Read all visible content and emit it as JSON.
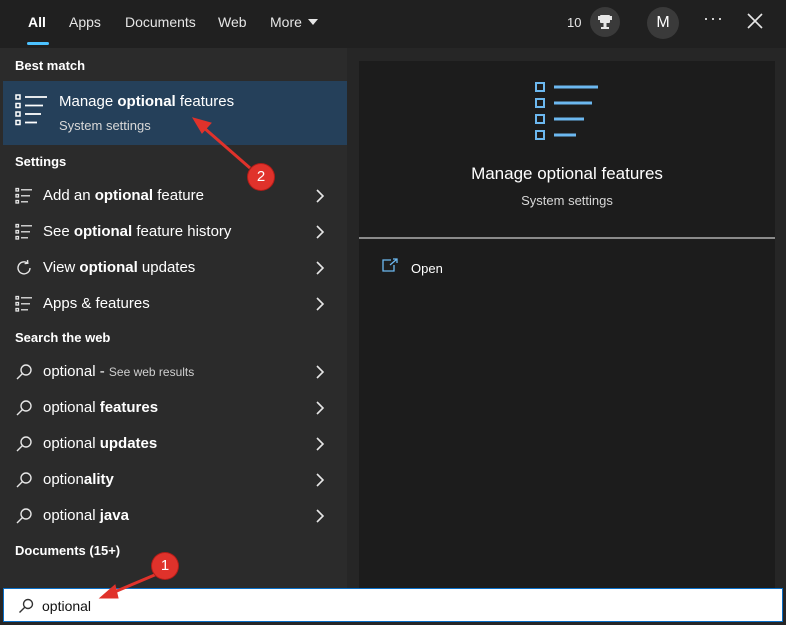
{
  "tabs": [
    {
      "label": "All"
    },
    {
      "label": "Apps"
    },
    {
      "label": "Documents"
    },
    {
      "label": "Web"
    },
    {
      "label": "More"
    }
  ],
  "header": {
    "points": "10",
    "avatar_initial": "M",
    "more_options": "···"
  },
  "best_match": {
    "heading": "Best match",
    "title_pre": "Manage ",
    "title_bold": "optional",
    "title_post": " features",
    "subtitle": "System settings",
    "icon": "list-settings-icon"
  },
  "settings": {
    "heading": "Settings",
    "items": [
      {
        "pre": "Add an ",
        "bold": "optional",
        "post": " feature",
        "icon": "list-icon"
      },
      {
        "pre": "See ",
        "bold": "optional",
        "post": " feature history",
        "icon": "list-icon"
      },
      {
        "pre": "View ",
        "bold": "optional",
        "post": " updates",
        "icon": "refresh-icon"
      },
      {
        "pre": "Apps & features",
        "bold": "",
        "post": "",
        "icon": "list-icon"
      }
    ]
  },
  "web": {
    "heading": "Search the web",
    "items": [
      {
        "pre": "optional",
        "bold": "",
        "post": " - ",
        "small": "See web results",
        "icon": "search-icon"
      },
      {
        "pre": "optional ",
        "bold": "features",
        "post": "",
        "small": "",
        "icon": "search-icon"
      },
      {
        "pre": "optional ",
        "bold": "updates",
        "post": "",
        "small": "",
        "icon": "search-icon"
      },
      {
        "pre": "option",
        "bold": "ality",
        "post": "",
        "small": "",
        "icon": "search-icon"
      },
      {
        "pre": "optional ",
        "bold": "java",
        "post": "",
        "small": "",
        "icon": "search-icon"
      }
    ]
  },
  "documents": {
    "heading": "Documents (15+)"
  },
  "preview": {
    "title": "Manage optional features",
    "subtitle": "System settings",
    "open_label": "Open",
    "icon": "list-settings-icon"
  },
  "search": {
    "value": "optional"
  },
  "annotations": {
    "badge_1": "1",
    "badge_2": "2"
  },
  "colors": {
    "accent": "#4cc2ff",
    "selected_row": "#25405a",
    "annotation": "#e0322b"
  }
}
